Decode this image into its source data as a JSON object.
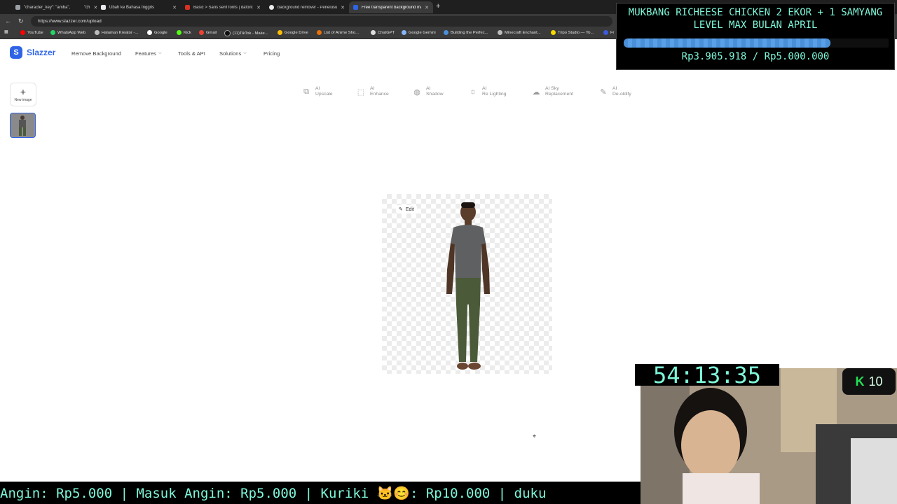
{
  "browser": {
    "tabs": [
      {
        "label": "\"character_key\": \"amba\",",
        "active": false
      },
      {
        "label": "\"ch",
        "active": false
      },
      {
        "label": "Ubah ke Bahasa Inggris",
        "active": false
      },
      {
        "label": "Basic > Sans serif fonts | dafont.co",
        "active": false
      },
      {
        "label": "background remover - Penelusura",
        "active": false
      },
      {
        "label": "Free transparent background mak",
        "active": true
      }
    ],
    "url": "https://www.slazzer.com/upload",
    "bookmarks": [
      "YouTube",
      "WhatsApp Web",
      "Halaman Kreator -...",
      "Google",
      "Kick",
      "Gmail",
      "(11)TikTok - Make...",
      "Google Drive",
      "List of Anime Sho...",
      "ChatGPT",
      "Google Gemini",
      "Building the Perfec...",
      "Minecraft Enchant...",
      "Tripo Studio — Yo...",
      "Fr"
    ]
  },
  "site": {
    "logo_text": "Slazzer",
    "nav": {
      "remove_background": "Remove Background",
      "features": "Features",
      "tools_api": "Tools & API",
      "solutions": "Solutions",
      "pricing": "Pricing"
    },
    "new_image_label": "New image",
    "tools": [
      {
        "line1": "AI",
        "line2": "Upscale",
        "icon": "upscale-icon"
      },
      {
        "line1": "AI",
        "line2": "Enhance",
        "icon": "enhance-icon"
      },
      {
        "line1": "AI",
        "line2": "Shadow",
        "icon": "shadow-icon"
      },
      {
        "line1": "AI",
        "line2": "Re Lighting",
        "icon": "relighting-icon"
      },
      {
        "line1": "AI Sky",
        "line2": "Replacement",
        "icon": "sky-replacement-icon"
      },
      {
        "line1": "AI",
        "line2": "De-oldify",
        "icon": "deoldify-icon"
      }
    ],
    "edit_label": "Edit"
  },
  "stream": {
    "donation_title": "MUKBANG RICHEESE CHICKEN 2 EKOR + 1 SAMYANG LEVEL MAX BULAN APRIL",
    "donation_amount": "Rp3.905.918 / Rp5.000.000",
    "donation_progress": 0.781,
    "timer": "54:13:35",
    "viewer_count": "10",
    "ticker": "Angin: Rp5.000 | Masuk Angin: Rp5.000 | Kuriki 🐱😊: Rp10.000 |  duku"
  },
  "colors": {
    "accent": "#2f64e6",
    "overlay_text": "#7ef7d9",
    "progress": "#4a90d9"
  }
}
